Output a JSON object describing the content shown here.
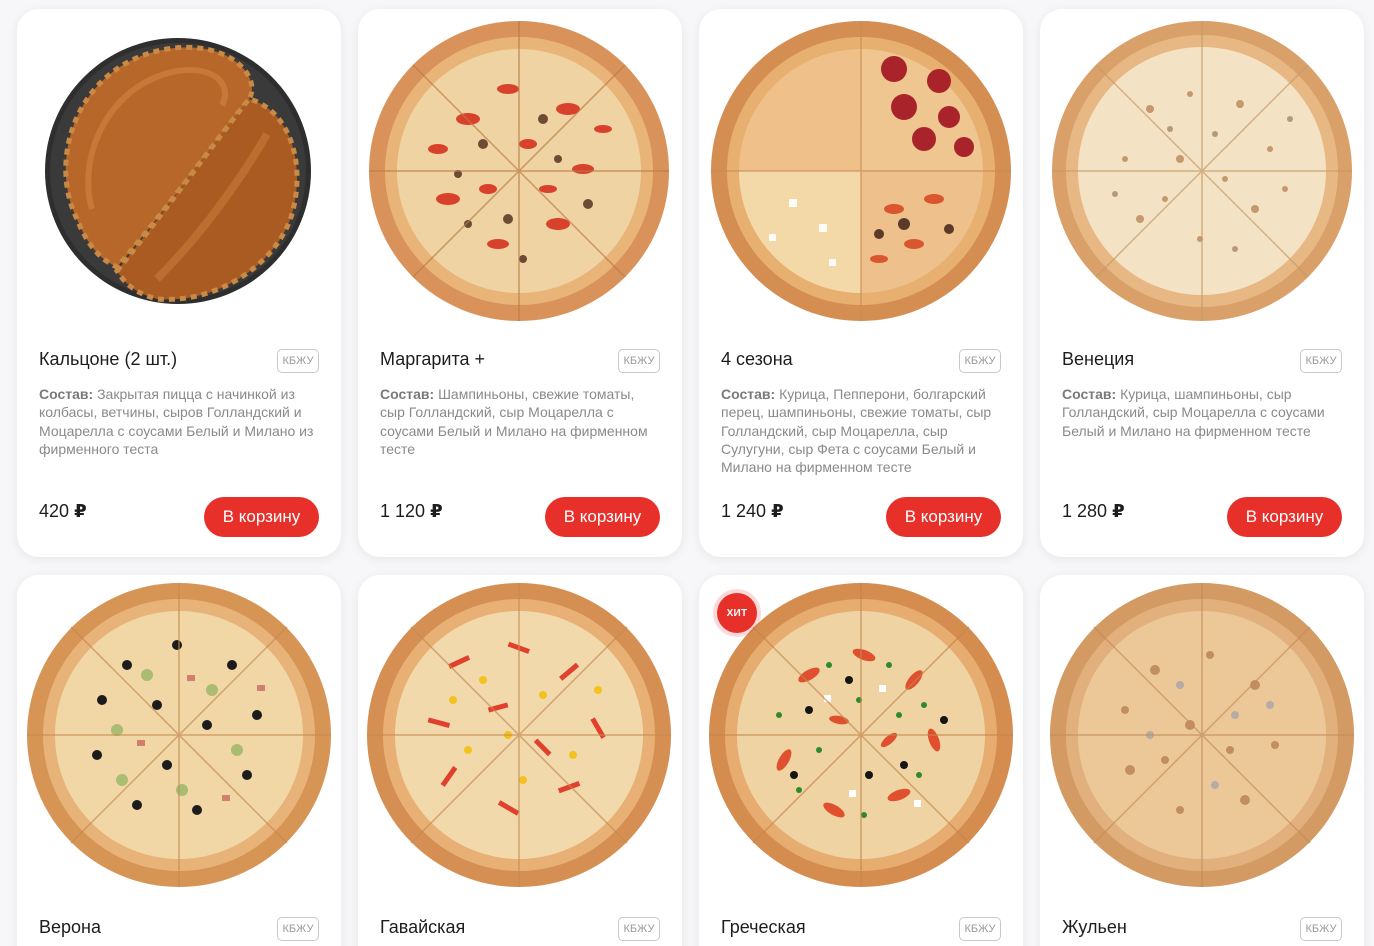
{
  "products": [
    {
      "name": "Кальцоне (2 шт.)",
      "kbju": "КБЖУ",
      "composition_label": "Состав:",
      "composition": "Закрытая пицца с начинкой из колбасы, ветчины, сыров Голландский и Моцарелла с соусами Белый и Милано из фирменного теста",
      "price": "420",
      "currency": "₽",
      "button": "В корзину",
      "image": "calzone"
    },
    {
      "name": "Маргарита +",
      "kbju": "КБЖУ",
      "composition_label": "Состав:",
      "composition": "Шампиньоны, свежие томаты, сыр Голландский, сыр Моцарелла с соусами Белый и Милано на фирменном тесте",
      "price": "1 120",
      "currency": "₽",
      "button": "В корзину",
      "image": "pizza-margarita"
    },
    {
      "name": "4 сезона",
      "kbju": "КБЖУ",
      "composition_label": "Состав:",
      "composition": "Курица, Пепперони, болгарский перец, шампиньоны, свежие томаты, сыр Голландский, сыр Моцарелла, сыр Сулугуни, сыр Фета с соусами Белый и Милано на фирменном тесте",
      "price": "1 240",
      "currency": "₽",
      "button": "В корзину",
      "image": "pizza-4-seasons"
    },
    {
      "name": "Венеция",
      "kbju": "КБЖУ",
      "composition_label": "Состав:",
      "composition": "Курица, шампиньоны, сыр Голландский, сыр Моцарелла с соусами Белый и Милано на фирменном тесте",
      "price": "1 280",
      "currency": "₽",
      "button": "В корзину",
      "image": "pizza-venice"
    },
    {
      "name": "Верона",
      "kbju": "КБЖУ",
      "image": "pizza-verona"
    },
    {
      "name": "Гавайская",
      "kbju": "КБЖУ",
      "image": "pizza-hawaiian"
    },
    {
      "name": "Греческая",
      "kbju": "КБЖУ",
      "badge": "ХИТ",
      "image": "pizza-greek"
    },
    {
      "name": "Жульен",
      "kbju": "КБЖУ",
      "image": "pizza-julienne"
    }
  ],
  "colors": {
    "accent": "#e8302b",
    "card_bg": "#ffffff",
    "page_bg": "#f7f7f9",
    "text": "#1d1d1d",
    "muted": "#8a8a8a"
  }
}
